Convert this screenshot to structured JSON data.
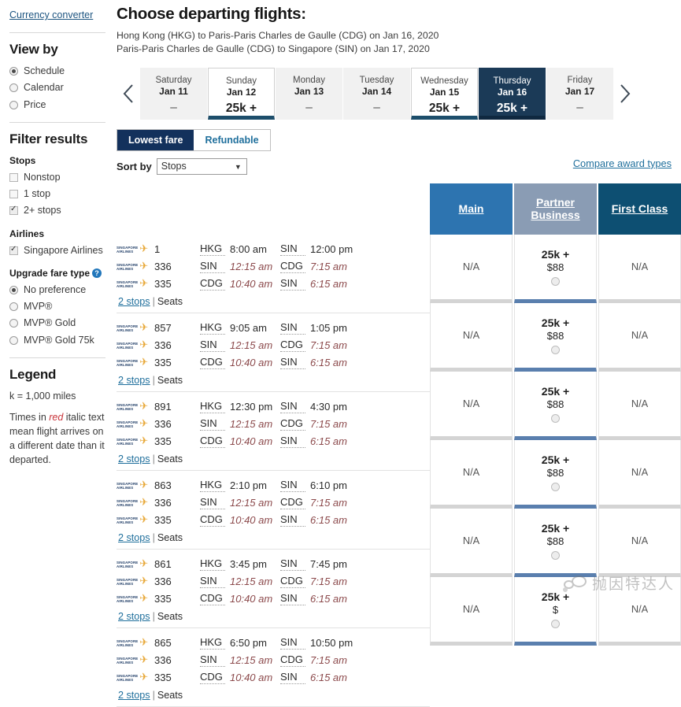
{
  "sidebar": {
    "currency_link": "Currency converter",
    "view_by": {
      "heading": "View by",
      "options": [
        {
          "label": "Schedule",
          "selected": true
        },
        {
          "label": "Calendar",
          "selected": false
        },
        {
          "label": "Price",
          "selected": false
        }
      ]
    },
    "filter": {
      "heading": "Filter results",
      "stops_heading": "Stops",
      "stops": [
        {
          "label": "Nonstop",
          "checked": false
        },
        {
          "label": "1 stop",
          "checked": false
        },
        {
          "label": "2+ stops",
          "checked": true
        }
      ],
      "airlines_heading": "Airlines",
      "airlines": [
        {
          "label": "Singapore Airlines",
          "checked": true
        }
      ],
      "upgrade_heading": "Upgrade fare type",
      "upgrade_help_icon": "question-mark-icon",
      "upgrade": [
        {
          "label": "No preference",
          "selected": true
        },
        {
          "label": "MVP®",
          "selected": false
        },
        {
          "label": "MVP® Gold",
          "selected": false
        },
        {
          "label": "MVP® Gold 75k",
          "selected": false
        }
      ]
    },
    "legend": {
      "heading": "Legend",
      "k_line": "k = 1,000 miles",
      "note_pre": "Times in ",
      "note_red": "red",
      "note_post": " italic text mean flight arrives on a different date than it departed."
    }
  },
  "header": {
    "title": "Choose departing flights:",
    "route_line_1": "Hong Kong (HKG) to Paris-Paris Charles de Gaulle (CDG) on Jan 16, 2020",
    "route_line_2": "Paris-Paris Charles de Gaulle (CDG) to Singapore (SIN) on Jan 17, 2020"
  },
  "datebar": {
    "prev_icon": "chevron-left-icon",
    "next_icon": "chevron-right-icon",
    "dates": [
      {
        "dow": "Saturday",
        "date": "Jan 11",
        "price": "–",
        "state": "none"
      },
      {
        "dow": "Sunday",
        "date": "Jan 12",
        "price": "25k +",
        "state": "avail"
      },
      {
        "dow": "Monday",
        "date": "Jan 13",
        "price": "–",
        "state": "none"
      },
      {
        "dow": "Tuesday",
        "date": "Jan 14",
        "price": "–",
        "state": "none"
      },
      {
        "dow": "Wednesday",
        "date": "Jan 15",
        "price": "25k +",
        "state": "avail"
      },
      {
        "dow": "Thursday",
        "date": "Jan 16",
        "price": "25k +",
        "state": "active"
      },
      {
        "dow": "Friday",
        "date": "Jan 17",
        "price": "–",
        "state": "none"
      }
    ]
  },
  "controls": {
    "fare_tabs": [
      {
        "label": "Lowest fare",
        "active": true
      },
      {
        "label": "Refundable",
        "active": false
      }
    ],
    "sort_label": "Sort by",
    "sort_value": "Stops",
    "sort_caret_icon": "caret-down-icon",
    "compare_link": "Compare award types"
  },
  "columns": [
    {
      "label": "Main",
      "color": "#2d74b0"
    },
    {
      "label": "Partner Business",
      "color": "#8a9cb4"
    },
    {
      "label": "First Class",
      "color": "#0d4f72"
    }
  ],
  "airline_logo": {
    "line1": "SINGAPORE",
    "line2": "AIRLINES",
    "bird_icon": "bird-logo-icon"
  },
  "fare_na": "N/A",
  "stops_text": "2 stops",
  "seats_text": "Seats",
  "rows": [
    {
      "segments": [
        {
          "flight": "1",
          "from": "HKG",
          "dep": "8:00 am",
          "to": "SIN",
          "arr": "12:00 pm",
          "next_day": false
        },
        {
          "flight": "336",
          "from": "SIN",
          "dep": "12:15 am",
          "to": "CDG",
          "arr": "7:15 am",
          "next_day": true
        },
        {
          "flight": "335",
          "from": "CDG",
          "dep": "10:40 am",
          "to": "SIN",
          "arr": "6:15 am",
          "next_day": true
        }
      ],
      "fares": [
        {
          "value": "N/A",
          "selected": false
        },
        {
          "value": "25k +",
          "usd": "$88",
          "selected": true
        },
        {
          "value": "N/A",
          "selected": false
        }
      ]
    },
    {
      "segments": [
        {
          "flight": "857",
          "from": "HKG",
          "dep": "9:05 am",
          "to": "SIN",
          "arr": "1:05 pm",
          "next_day": false
        },
        {
          "flight": "336",
          "from": "SIN",
          "dep": "12:15 am",
          "to": "CDG",
          "arr": "7:15 am",
          "next_day": true
        },
        {
          "flight": "335",
          "from": "CDG",
          "dep": "10:40 am",
          "to": "SIN",
          "arr": "6:15 am",
          "next_day": true
        }
      ],
      "fares": [
        {
          "value": "N/A",
          "selected": false
        },
        {
          "value": "25k +",
          "usd": "$88",
          "selected": true
        },
        {
          "value": "N/A",
          "selected": false
        }
      ]
    },
    {
      "segments": [
        {
          "flight": "891",
          "from": "HKG",
          "dep": "12:30 pm",
          "to": "SIN",
          "arr": "4:30 pm",
          "next_day": false
        },
        {
          "flight": "336",
          "from": "SIN",
          "dep": "12:15 am",
          "to": "CDG",
          "arr": "7:15 am",
          "next_day": true
        },
        {
          "flight": "335",
          "from": "CDG",
          "dep": "10:40 am",
          "to": "SIN",
          "arr": "6:15 am",
          "next_day": true
        }
      ],
      "fares": [
        {
          "value": "N/A",
          "selected": false
        },
        {
          "value": "25k +",
          "usd": "$88",
          "selected": true
        },
        {
          "value": "N/A",
          "selected": false
        }
      ]
    },
    {
      "segments": [
        {
          "flight": "863",
          "from": "HKG",
          "dep": "2:10 pm",
          "to": "SIN",
          "arr": "6:10 pm",
          "next_day": false
        },
        {
          "flight": "336",
          "from": "SIN",
          "dep": "12:15 am",
          "to": "CDG",
          "arr": "7:15 am",
          "next_day": true
        },
        {
          "flight": "335",
          "from": "CDG",
          "dep": "10:40 am",
          "to": "SIN",
          "arr": "6:15 am",
          "next_day": true
        }
      ],
      "fares": [
        {
          "value": "N/A",
          "selected": false
        },
        {
          "value": "25k +",
          "usd": "$88",
          "selected": true
        },
        {
          "value": "N/A",
          "selected": false
        }
      ]
    },
    {
      "segments": [
        {
          "flight": "861",
          "from": "HKG",
          "dep": "3:45 pm",
          "to": "SIN",
          "arr": "7:45 pm",
          "next_day": false
        },
        {
          "flight": "336",
          "from": "SIN",
          "dep": "12:15 am",
          "to": "CDG",
          "arr": "7:15 am",
          "next_day": true
        },
        {
          "flight": "335",
          "from": "CDG",
          "dep": "10:40 am",
          "to": "SIN",
          "arr": "6:15 am",
          "next_day": true
        }
      ],
      "fares": [
        {
          "value": "N/A",
          "selected": false
        },
        {
          "value": "25k +",
          "usd": "$88",
          "selected": true
        },
        {
          "value": "N/A",
          "selected": false
        }
      ]
    },
    {
      "segments": [
        {
          "flight": "865",
          "from": "HKG",
          "dep": "6:50 pm",
          "to": "SIN",
          "arr": "10:50 pm",
          "next_day": false
        },
        {
          "flight": "336",
          "from": "SIN",
          "dep": "12:15 am",
          "to": "CDG",
          "arr": "7:15 am",
          "next_day": true
        },
        {
          "flight": "335",
          "from": "CDG",
          "dep": "10:40 am",
          "to": "SIN",
          "arr": "6:15 am",
          "next_day": true
        }
      ],
      "fares": [
        {
          "value": "N/A",
          "selected": false
        },
        {
          "value": "25k +",
          "usd": "$",
          "selected": true
        },
        {
          "value": "N/A",
          "selected": false
        }
      ]
    }
  ],
  "watermark": {
    "text": "抛因特达人",
    "logo_icon": "wechat-logo-icon"
  }
}
